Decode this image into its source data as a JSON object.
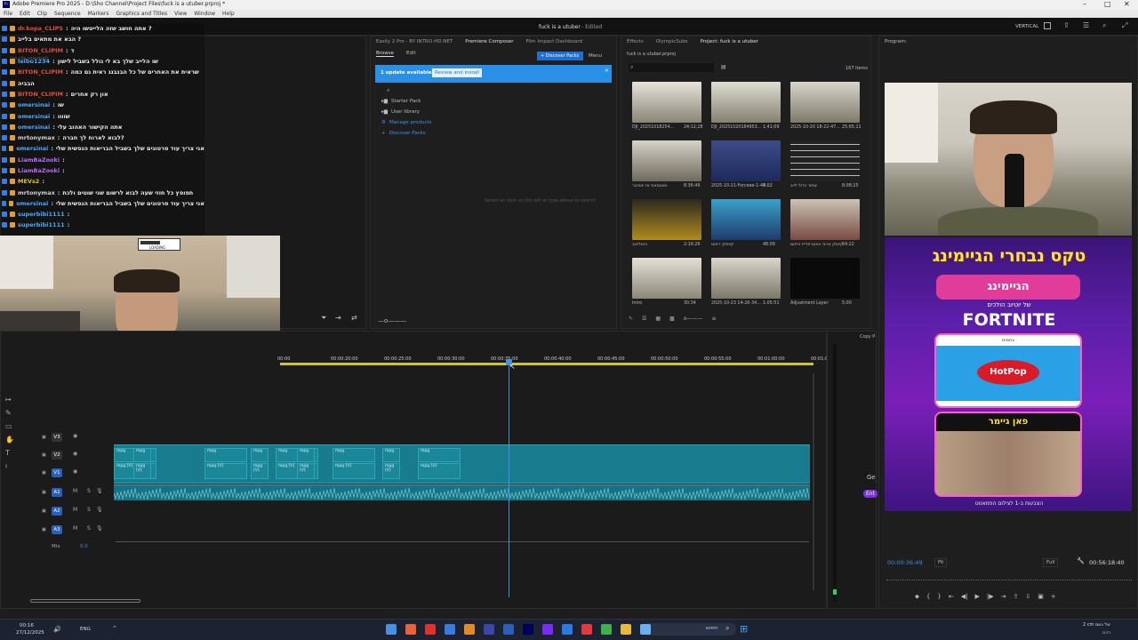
{
  "window": {
    "title": "Adobe Premiere Pro 2025 - D:\\Sho Channel\\Project Files\\fuck is a utuber.prproj *",
    "menu": [
      "File",
      "Edit",
      "Clip",
      "Sequence",
      "Markers",
      "Graphics and Titles",
      "View",
      "Window",
      "Help"
    ],
    "project_name": "fuck is a utuber",
    "edited": "- Edited",
    "layout_label": "VERTICAL"
  },
  "chat": {
    "lines": [
      {
        "user": "dr.kopa_CLIPS",
        "text": "אתה חושב שזה הלייטשו היה ?",
        "color": "#e0503a"
      },
      {
        "user": "",
        "text": "הבא את מתאים בלייב ?",
        "color": "#e0503a"
      },
      {
        "user": "BITON_CLIPIM",
        "text": "ד",
        "color": "#e0503a"
      },
      {
        "user": "leibo1234",
        "text": "שו הלייב שלך בא לי גולל בשביל לישון",
        "color": "#4aa8ff"
      },
      {
        "user": "BITON_CLIPIM",
        "text": "שראית את האחרים של כל הבנבנג ראית גם כמה",
        "color": "#e0503a"
      },
      {
        "user": "",
        "text": "הבביה",
        "color": "#d0d0d0"
      },
      {
        "user": "BITON_CLIPIM",
        "text": "און רק אחרים",
        "color": "#e0503a"
      },
      {
        "user": "omersinai",
        "text": "שו",
        "color": "#4aa8ff"
      },
      {
        "user": "omersinai",
        "text": "שוווו",
        "color": "#4aa8ff"
      },
      {
        "user": "omersinai",
        "text": "אתה הקישור האהוב עלי",
        "color": "#4aa8ff"
      },
      {
        "user": "mrtonymax",
        "text": "לבוא לארוח לך חברה?",
        "color": "#d0d0d0"
      },
      {
        "user": "omersinai",
        "text": "אני צריך עוד סרטונים שלך בשביל הבריאות הנפשית שלי",
        "color": "#4aa8ff"
      },
      {
        "user": "LiamBaZooki",
        "text": "",
        "color": "#b86bff"
      },
      {
        "user": "LiamBaZooki",
        "text": "",
        "color": "#b86bff"
      },
      {
        "user": "MEVs2",
        "text": "",
        "color": "#e0c030"
      },
      {
        "user": "mrtonymax",
        "text": "תפוסץ כל חוזי שעה לבוא לרשום שני שוטים ולכת",
        "color": "#d0d0d0"
      },
      {
        "user": "omersinai",
        "text": "אני צריך עוד סרטונים שלך בשביל הבריאות הנפשית שלי",
        "color": "#4aa8ff"
      },
      {
        "user": "superbibi1111",
        "text": "",
        "color": "#4aa8ff"
      },
      {
        "user": "superbibi1111",
        "text": "",
        "color": "#4aa8ff"
      }
    ],
    "no_clip": "(no clip selected)"
  },
  "webcam": {
    "loading": "LOADING"
  },
  "essential": {
    "tabs": [
      "Easily 2 Pro - BY INTRO-HD.NET",
      "Premiere Composer",
      "Film Impact Dashboard"
    ],
    "subtabs": [
      "Browse",
      "Edit"
    ],
    "discover_button": "+ Discover Packs",
    "menu_label": "Menu",
    "update_text": "1 update available",
    "review_button": "Review and install",
    "tree": [
      "Starter Pack",
      "User library",
      "Manage products",
      "Discover Packs"
    ],
    "empty_hint": "Select an item on the left or type above to search"
  },
  "project": {
    "tabs": [
      "Effects",
      "OlympicSubs",
      "Project: fuck is a utuber"
    ],
    "file": "fuck is a utuber.prproj",
    "items_count": "167 items",
    "items": [
      {
        "name": "DJI_20251018254...",
        "dur": "24;12;28"
      },
      {
        "name": "DJI_20251020184953...",
        "dur": "1;41;09"
      },
      {
        "name": "2025-10-20 18-22-47...",
        "dur": "25;65;11"
      },
      {
        "name": "וואטסאפ אז יוטיובר",
        "dur": "8:36:46"
      },
      {
        "name": "2025-10-21-Forceee-1-40...",
        "dur": "4:02"
      },
      {
        "name": "שחור גדול לייב",
        "dur": "8:08:25"
      },
      {
        "name": "כאוליגוב",
        "dur": "2:16:26"
      },
      {
        "name": "קיוסקי ראוט",
        "dur": "48:09"
      },
      {
        "name": "קיוסק ארבי אינטרפרייז כיתום",
        "dur": "54:22"
      },
      {
        "name": "Intro",
        "dur": "30:34"
      },
      {
        "name": "2025-10-23 14-26-34...",
        "dur": "1:05:51"
      },
      {
        "name": "Adjustment Layer",
        "dur": "5:00"
      }
    ]
  },
  "program": {
    "label": "Program:",
    "timecode": "00:00:36:49",
    "fit": "Fit",
    "full": "Full",
    "duration": "00:56:18:40",
    "overlay_title": "טקס נבחרי הגיימינג",
    "overlay_sub": "של יוטיוב הולכים",
    "overlay_game": "FORTNITE",
    "overlay_small": "בחסות",
    "overlay_sponsor": "HotPop",
    "overlay_category": "פאן גיימר",
    "overlay_bottom": "הצבעות ב-1 לצילום הפמאנוט"
  },
  "timeline": {
    "ticks": [
      "00:00",
      "00:00:20:00",
      "00:00:25:00",
      "00:00:30:00",
      "00:00:35:00",
      "00:00:40:00",
      "00:00:45:00",
      "00:00:50:00",
      "00:00:55:00",
      "00:01:00:00",
      "00:01:0"
    ],
    "tracks": [
      {
        "name": "V3",
        "type": "video"
      },
      {
        "name": "V2",
        "type": "video"
      },
      {
        "name": "V1",
        "type": "video"
      },
      {
        "name": "A1",
        "type": "audio"
      },
      {
        "name": "A2",
        "type": "audio"
      },
      {
        "name": "A3",
        "type": "audio"
      }
    ],
    "mix_label": "Mix",
    "mix_value": "0.0",
    "clip_label_v2": "mpg",
    "clip_label_v1": "mpg [V]",
    "clip_label_a1": "mpg [A]",
    "copy_label": "Copy P",
    "side_label": "Ge",
    "side_button": "Ent"
  },
  "taskbar": {
    "time": "00:16",
    "date": "27/12/2025",
    "lang": "ENG",
    "search_placeholder": "חיפוש",
    "weather": "2 cm של גשם",
    "weather_sub": "היום"
  }
}
